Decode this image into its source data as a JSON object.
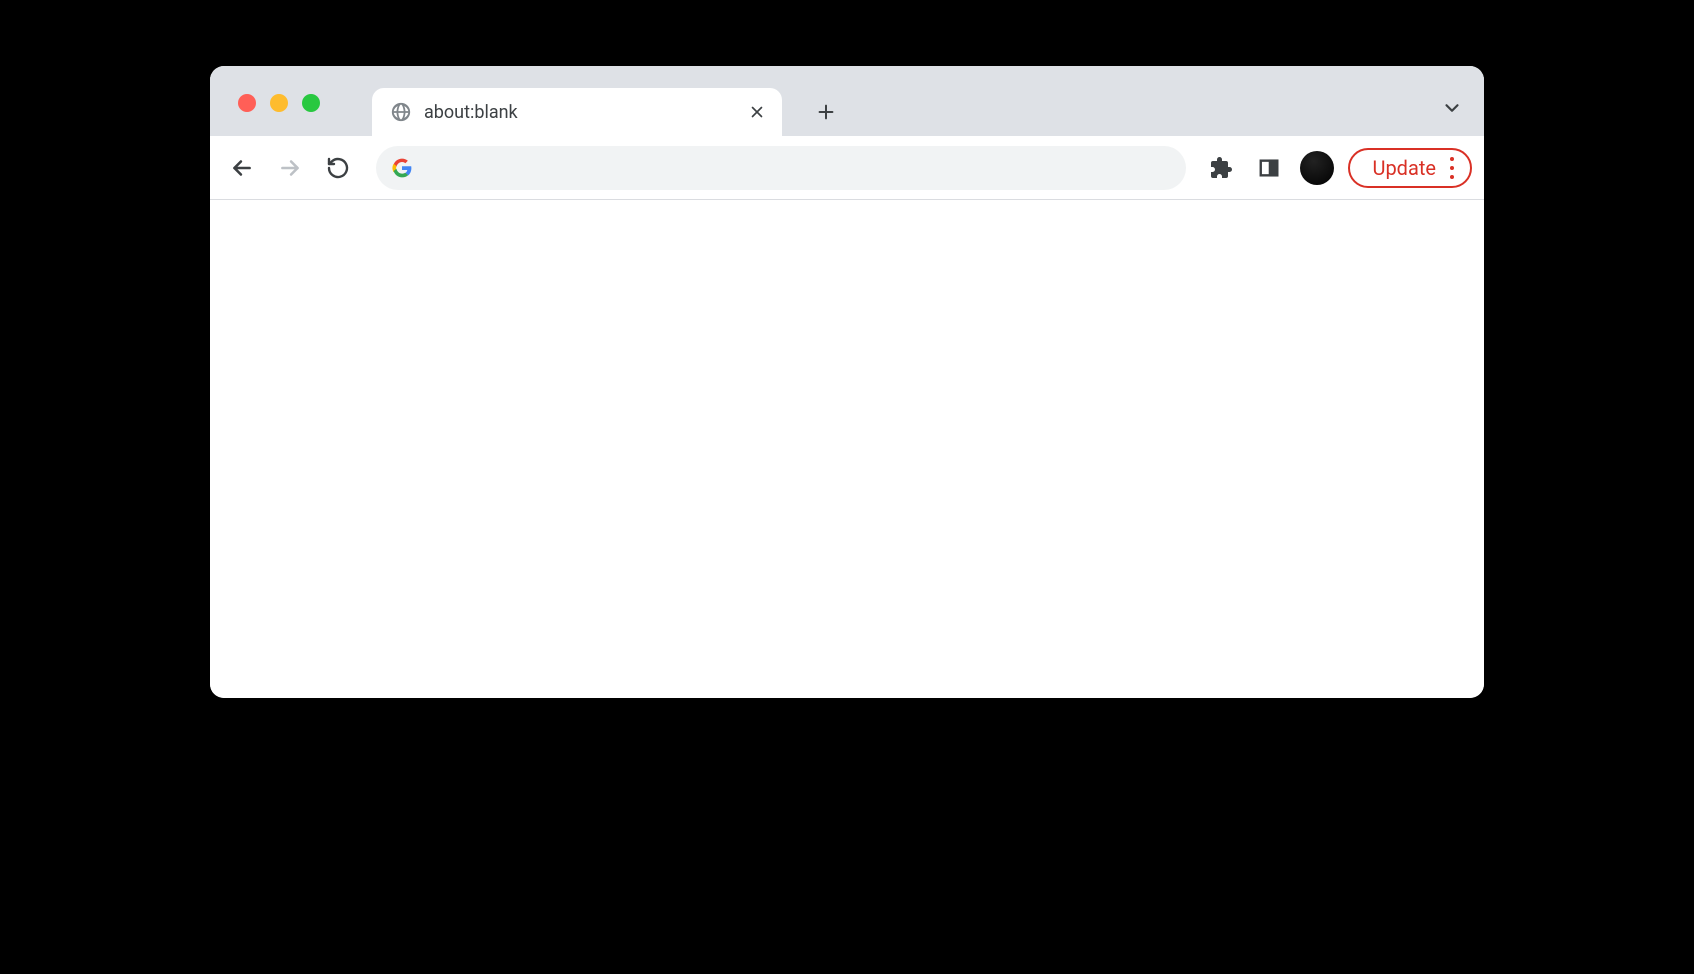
{
  "tab": {
    "title": "about:blank"
  },
  "omnibox": {
    "value": "",
    "placeholder": ""
  },
  "update_button": {
    "label": "Update"
  },
  "colors": {
    "accent_red": "#d93025",
    "tab_strip_bg": "#dee1e6"
  }
}
